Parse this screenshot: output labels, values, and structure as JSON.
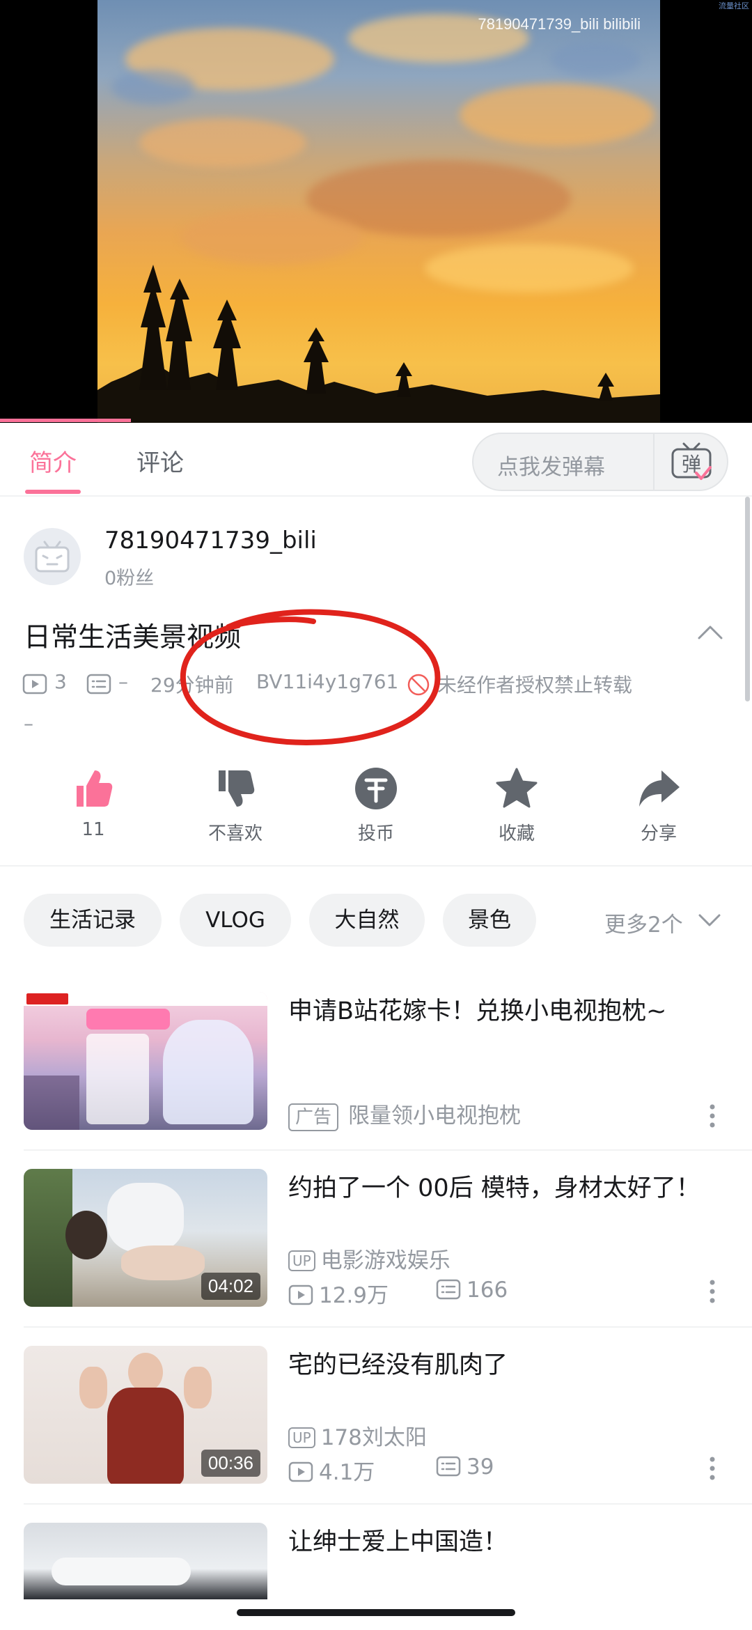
{
  "player": {
    "watermark": "78190471739_bili bilibili",
    "corner_text": "流量社区"
  },
  "tabs": {
    "intro": "简介",
    "comments": "评论",
    "danmaku_placeholder": "点我发弹幕",
    "danmaku_icon": "danmaku-send-icon"
  },
  "uploader": {
    "name": "78190471739_bili",
    "fans": "0粉丝"
  },
  "video": {
    "title": "日常生活美景视频",
    "views": "3",
    "danmaku": "–",
    "time": "29分钟前",
    "bvid": "BV11i4y1g761",
    "copyright": "未经作者授权禁止转载",
    "description": "–",
    "annotation_color": "#e0231c"
  },
  "actions": [
    {
      "label": "11",
      "icon": "like-icon"
    },
    {
      "label": "不喜欢",
      "icon": "dislike-icon"
    },
    {
      "label": "投币",
      "icon": "coin-icon"
    },
    {
      "label": "收藏",
      "icon": "favorite-icon"
    },
    {
      "label": "分享",
      "icon": "share-icon"
    }
  ],
  "tags": [
    "生活记录",
    "VLOG",
    "大自然",
    "景色"
  ],
  "more_tags": "更多2个",
  "related": [
    {
      "title": "申请B站花嫁卡！兑换小电视抱枕~",
      "ad_badge": "广告",
      "ad_text": "限量领小电视抱枕"
    },
    {
      "title": "约拍了一个 00后  模特，身材太好了！",
      "up_badge": "UP",
      "uploader": "电影游戏娱乐",
      "views": "12.9万",
      "danmaku": "166",
      "duration": "04:02"
    },
    {
      "title": "宅的已经没有肌肉了",
      "up_badge": "UP",
      "uploader": "178刘太阳",
      "views": "4.1万",
      "danmaku": "39",
      "duration": "00:36"
    },
    {
      "title": "让绅士爱上中国造！"
    }
  ],
  "colors": {
    "accent": "#fb7299",
    "text_primary": "#18191c",
    "text_secondary": "#9499a0"
  }
}
